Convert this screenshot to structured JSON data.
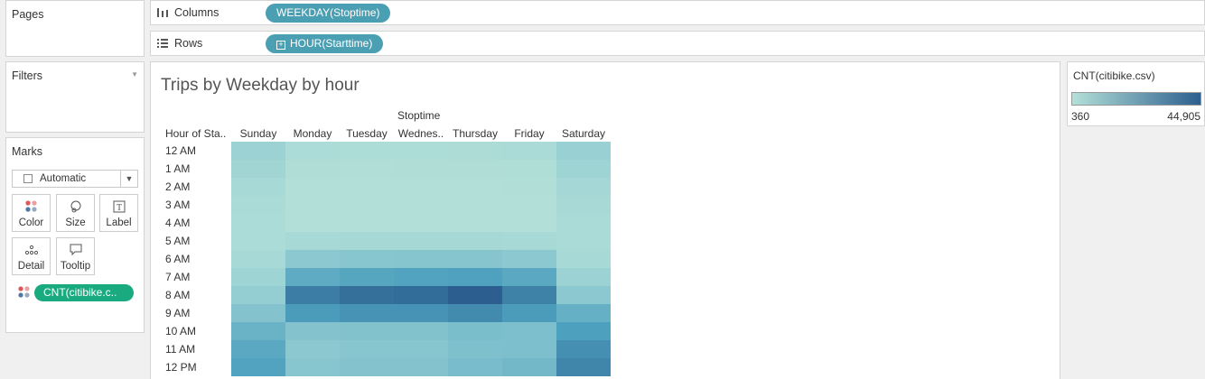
{
  "pages": {
    "title": "Pages"
  },
  "filters": {
    "title": "Filters"
  },
  "marks": {
    "title": "Marks",
    "mark_type": "Automatic",
    "buttons": [
      {
        "label": "Color",
        "icon": "color-dots-icon"
      },
      {
        "label": "Size",
        "icon": "size-icon"
      },
      {
        "label": "Label",
        "icon": "label-icon"
      },
      {
        "label": "Detail",
        "icon": "detail-icon"
      },
      {
        "label": "Tooltip",
        "icon": "tooltip-icon"
      }
    ],
    "color_field": "CNT(citibike.c.."
  },
  "columns_shelf": {
    "label": "Columns",
    "pill": "WEEKDAY(Stoptime)"
  },
  "rows_shelf": {
    "label": "Rows",
    "pill": "HOUR(Starttime)"
  },
  "view": {
    "title": "Trips by Weekday by hour",
    "column_group": "Stoptime",
    "row_header": "Hour of Sta..",
    "columns": [
      "Sunday",
      "Monday",
      "Tuesday",
      "Wednes..",
      "Thursday",
      "Friday",
      "Saturday"
    ],
    "rows": [
      "12 AM",
      "1 AM",
      "2 AM",
      "3 AM",
      "4 AM",
      "5 AM",
      "6 AM",
      "7 AM",
      "8 AM",
      "9 AM",
      "10 AM",
      "11 AM",
      "12 PM"
    ]
  },
  "legend": {
    "title": "CNT(citibike.csv)",
    "min": "360",
    "max": "44,905",
    "colors": {
      "low": "#b3e0d8",
      "high": "#2c5f8f"
    }
  },
  "chart_data": {
    "type": "heatmap",
    "x_categories": [
      "Sunday",
      "Monday",
      "Tuesday",
      "Wednes..",
      "Thursday",
      "Friday",
      "Saturday"
    ],
    "y_categories": [
      "12 AM",
      "1 AM",
      "2 AM",
      "3 AM",
      "4 AM",
      "5 AM",
      "6 AM",
      "7 AM",
      "8 AM",
      "9 AM",
      "10 AM",
      "11 AM",
      "12 PM"
    ],
    "values": [
      [
        9000,
        3000,
        2500,
        2500,
        2700,
        3200,
        10000
      ],
      [
        7000,
        1500,
        1200,
        1300,
        1400,
        1800,
        8000
      ],
      [
        5000,
        900,
        800,
        800,
        900,
        1200,
        6000
      ],
      [
        3500,
        700,
        600,
        600,
        700,
        900,
        4500
      ],
      [
        3000,
        700,
        600,
        600,
        700,
        800,
        3500
      ],
      [
        3000,
        5000,
        5200,
        5300,
        5200,
        5000,
        3500
      ],
      [
        5000,
        15000,
        16000,
        16500,
        16500,
        15000,
        5000
      ],
      [
        8000,
        26000,
        28000,
        29000,
        29500,
        27000,
        9000
      ],
      [
        12000,
        38000,
        41000,
        42000,
        44905,
        37000,
        15000
      ],
      [
        17000,
        31000,
        33000,
        33000,
        35000,
        31000,
        24000
      ],
      [
        23000,
        17000,
        17500,
        17500,
        19000,
        18500,
        30000
      ],
      [
        27000,
        15000,
        16000,
        16000,
        18000,
        18500,
        34000
      ],
      [
        29000,
        16000,
        17000,
        17000,
        19500,
        21000,
        36000
      ]
    ],
    "color_range": [
      360,
      44905
    ],
    "xlabel": "Stoptime",
    "ylabel": "Hour of Sta.."
  }
}
